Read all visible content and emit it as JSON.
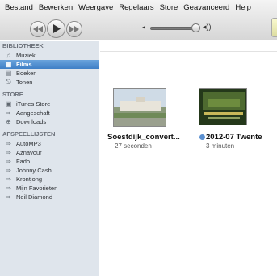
{
  "menu": [
    "Bestand",
    "Bewerken",
    "Weergave",
    "Regelaars",
    "Store",
    "Geavanceerd",
    "Help"
  ],
  "sidebar": {
    "sections": [
      {
        "title": "BIBLIOTHEEK",
        "items": [
          {
            "label": "Muziek",
            "icon": "music-note-icon"
          },
          {
            "label": "Films",
            "icon": "film-icon",
            "selected": true
          },
          {
            "label": "Boeken",
            "icon": "book-icon"
          },
          {
            "label": "Tonen",
            "icon": "bell-icon"
          }
        ]
      },
      {
        "title": "STORE",
        "items": [
          {
            "label": "iTunes Store",
            "icon": "store-icon"
          },
          {
            "label": "Aangeschaft",
            "icon": "playlist-icon"
          },
          {
            "label": "Downloads",
            "icon": "download-icon"
          }
        ]
      },
      {
        "title": "AFSPEELLIJSTEN",
        "items": [
          {
            "label": "AutoMP3",
            "icon": "playlist-icon"
          },
          {
            "label": "Aznavour",
            "icon": "playlist-icon"
          },
          {
            "label": "Fado",
            "icon": "playlist-icon"
          },
          {
            "label": "Johnny Cash",
            "icon": "playlist-icon"
          },
          {
            "label": "Krontjong",
            "icon": "playlist-icon"
          },
          {
            "label": "Mijn Favorieten",
            "icon": "playlist-icon"
          },
          {
            "label": "Neil Diamond",
            "icon": "playlist-icon"
          }
        ]
      }
    ]
  },
  "movies": [
    {
      "title": "Soestdijk_convert...",
      "duration": "27 seconden"
    },
    {
      "title": "2012-07 Twente",
      "duration": "3 minuten",
      "icloud": true
    }
  ],
  "colors": {
    "selected": "#3f7fc6",
    "sidebar_bg": "#dfe5ec"
  }
}
